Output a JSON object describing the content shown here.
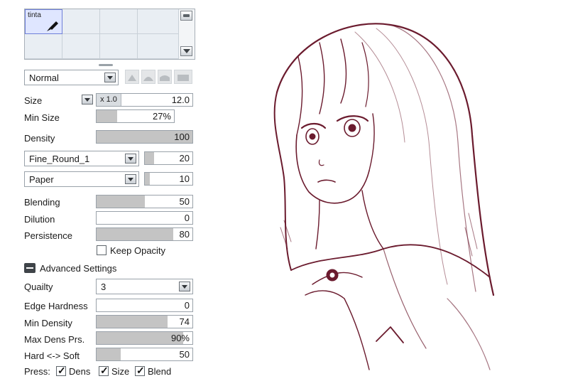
{
  "tool_grid": {
    "tools": [
      {
        "label": "tinta",
        "selected": true
      }
    ]
  },
  "blend_mode": "Normal",
  "brush_shapes": [
    "triangle-shape-icon",
    "round-shape-icon",
    "semi-round-shape-icon",
    "square-shape-icon"
  ],
  "size": {
    "label": "Size",
    "multiplier": "x 1.0",
    "value": "12.0"
  },
  "min_size": {
    "label": "Min Size",
    "value": "27%",
    "fill": 0.27
  },
  "density": {
    "label": "Density",
    "value": "100",
    "fill": 1.0
  },
  "shape_tex": {
    "name": "Fine_Round_1",
    "value": "20",
    "fill": 0.2
  },
  "paper_tex": {
    "name": "Paper",
    "value": "10",
    "fill": 0.1
  },
  "blending": {
    "label": "Blending",
    "value": "50",
    "fill": 0.5
  },
  "dilution": {
    "label": "Dilution",
    "value": "0",
    "fill": 0.0
  },
  "persistence": {
    "label": "Persistence",
    "value": "80",
    "fill": 0.8
  },
  "keep_opacity": {
    "label": "Keep Opacity",
    "checked": false
  },
  "advanced": {
    "label": "Advanced Settings"
  },
  "quality": {
    "label": "Quailty",
    "value": "3"
  },
  "edge_hardness": {
    "label": "Edge Hardness",
    "value": "0",
    "fill": 0.0
  },
  "min_density": {
    "label": "Min Density",
    "value": "74",
    "fill": 0.74
  },
  "max_dens_prs": {
    "label": "Max Dens Prs.",
    "value": "90%",
    "fill": 0.9
  },
  "hard_soft": {
    "label": "Hard <-> Soft",
    "value": "50",
    "fill": 0.25
  },
  "press": {
    "label": "Press:",
    "dens": "Dens",
    "size": "Size",
    "blend": "Blend"
  },
  "colors": {
    "ink": "#6b1b2e",
    "fill": "#c4c4c4",
    "accent": "#6f7fd8"
  }
}
